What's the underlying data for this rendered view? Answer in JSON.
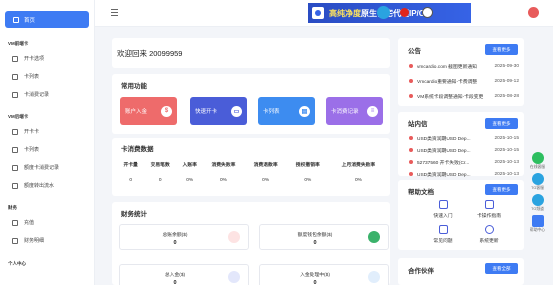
{
  "sidebar": {
    "home": "首页",
    "sections": [
      {
        "title": "VM前端卡",
        "items": [
          "开卡选项",
          "卡列表",
          "卡消费记录"
        ]
      },
      {
        "title": "VM后端卡",
        "items": [
          "开卡卡",
          "卡列表",
          "额度卡消费记录",
          "额度转出流水"
        ]
      },
      {
        "title": "财务",
        "items": [
          "充值",
          "财务明细"
        ]
      },
      {
        "title": "个人中心",
        "items": []
      }
    ]
  },
  "topbar": {
    "ad_highlight": "高纯净度",
    "ad_rest": "原生住宅代理IP/GB"
  },
  "welcome": "欢迎回来 20099959",
  "common_functions": {
    "title": "常用功能",
    "buttons": [
      {
        "label": "账户入金",
        "color": "#ee6b6b",
        "icon": "$"
      },
      {
        "label": "快速开卡",
        "color": "#4a5dd8",
        "icon": "▭"
      },
      {
        "label": "卡列表",
        "color": "#3d8cf0",
        "icon": "▤"
      },
      {
        "label": "卡消费记录",
        "color": "#9b6fe8",
        "icon": "≡"
      }
    ]
  },
  "card_stats": {
    "title": "卡消费数据",
    "headers": [
      "开卡量",
      "交易笔数",
      "入账率",
      "消费失败率",
      "消费退款率",
      "授权撤销率",
      "上月消费失败率"
    ],
    "values": [
      "0",
      "0",
      "0%",
      "0%",
      "0%",
      "0%",
      "0%"
    ]
  },
  "finance": {
    "title": "财务统计",
    "boxes": [
      {
        "label": "总账余额($)",
        "value": "0",
        "icon_color": "#e85b5b"
      },
      {
        "label": "额度钱包余额($)",
        "value": "0",
        "icon_color": "#3bb26b"
      },
      {
        "label": "总入金($)",
        "value": "0",
        "icon_color": "#4a5dd8"
      },
      {
        "label": "入金处理中($)",
        "value": "0",
        "icon_color": "#3d8cf0"
      }
    ]
  },
  "announcements": {
    "title": "公告",
    "more": "查看更多",
    "items": [
      {
        "text": "vmcardio.com 截图更新通知",
        "date": "2025-09-30"
      },
      {
        "text": "Vmcardio重要通知-卡费调整",
        "date": "2025-09-12"
      },
      {
        "text": "VM系统卡段调整通知-卡段变更",
        "date": "2025-08-28"
      }
    ]
  },
  "messages": {
    "title": "站内信",
    "more": "查看更多",
    "items": [
      {
        "text": "USD类资润期USD Dep...",
        "date": "2025-10-15"
      },
      {
        "text": "USD类资润期USD Dep...",
        "date": "2025-10-15"
      },
      {
        "text": "52737560 开卡失败(Cr...",
        "date": "2025-10-13"
      },
      {
        "text": "USD类资润期USD Dep...",
        "date": "2025-10-13"
      }
    ]
  },
  "help": {
    "title": "帮助文档",
    "more": "查看更多",
    "items": [
      "快速入门",
      "卡操作指南",
      "常见问题",
      "系统更新"
    ]
  },
  "partners": {
    "title": "合作伙伴",
    "more": "查看全部"
  },
  "floatbar": [
    "在线客服",
    "TG客服",
    "TG频道",
    "帮助中心"
  ]
}
